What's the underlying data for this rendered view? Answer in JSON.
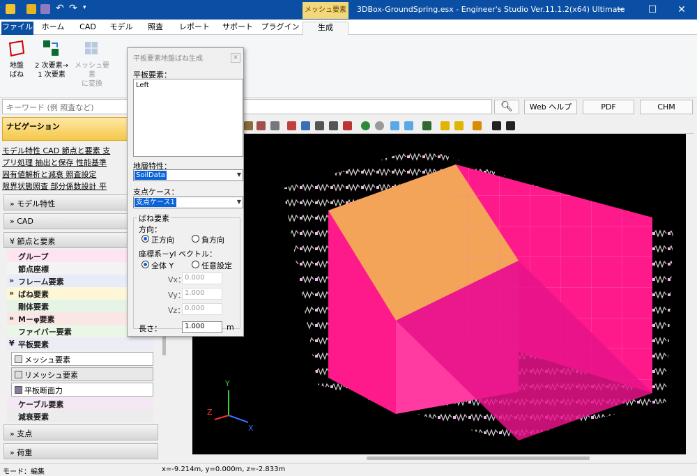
{
  "window": {
    "title": "3DBox-GroundSpring.esx - Engineer's Studio Ver.11.1.2(x64) Ultimate",
    "context_tab": "メッシュ要素"
  },
  "menu": {
    "tabs": [
      "ファイル",
      "ホーム",
      "CAD",
      "モデル",
      "照査",
      "レポート",
      "サポート",
      "プラグイン",
      "生成"
    ]
  },
  "ribbon": {
    "btn1": {
      "l1": "地盤",
      "l2": "ばね"
    },
    "btn2": {
      "l1": "2 次要素→",
      "l2": "1 次要素"
    },
    "btn3": {
      "l1": "メッシュ要素",
      "l2": "に変換"
    }
  },
  "search": {
    "placeholder": "キーワード (例 照査など)",
    "web_help": "Web ヘルプ",
    "pdf": "PDF",
    "chm": "CHM"
  },
  "nav": {
    "header": "ナビゲーション",
    "links": [
      "モデル特性 CAD 節点と要素 支",
      "プリ処理 抽出と保存 性能基準",
      "固有値解析と減衰 照査設定",
      "限界状態照査 部分係数設計 平"
    ],
    "sections": [
      "モデル特性",
      "CAD",
      "節点と要素",
      "支点",
      "荷重"
    ],
    "items": [
      "グループ",
      "節点座標",
      "フレーム要素",
      "ばね要素",
      "剛体要素",
      "M－φ要素",
      "ファイバー要素",
      "平板要素",
      "ケーブル要素",
      "減衰要素"
    ],
    "subitems": [
      "メッシュ要素",
      "リメッシュ要素",
      "平板断面力"
    ]
  },
  "dialog": {
    "title": "平板要素地盤ばね生成",
    "plate_label": "平板要素：",
    "plate_value": "Left",
    "soil_label": "地層特性：",
    "soil_value": "SoilData",
    "support_label": "支点ケース：",
    "support_value": "支点ケース1",
    "spring_group": "ばね要素",
    "dir_label": "方向：",
    "dir_pos": "正方向",
    "dir_neg": "負方向",
    "coord_label": "座標系－yl ベクトル：",
    "coord_global": "全体 Y",
    "coord_custom": "任意設定",
    "vx_label": "Vx：",
    "vx": "0.000",
    "vy_label": "Vy：",
    "vy": "1.000",
    "vz_label": "Vz：",
    "vz": "0.000",
    "len_label": "長さ：",
    "len": "1.000",
    "len_unit": "m"
  },
  "axes": {
    "y": "Y",
    "z": "Z",
    "x": "X"
  },
  "status": {
    "mode": "モード：編集",
    "coords": "x=-9.214m, y=0.000m, z=-2.833m"
  },
  "colors": {
    "title_bar": "#0a4fa3",
    "box_face": "#ff1a8c",
    "box_top": "#f4a458",
    "spring": "#d8d8d8",
    "context_tab": "#f3d77a"
  }
}
